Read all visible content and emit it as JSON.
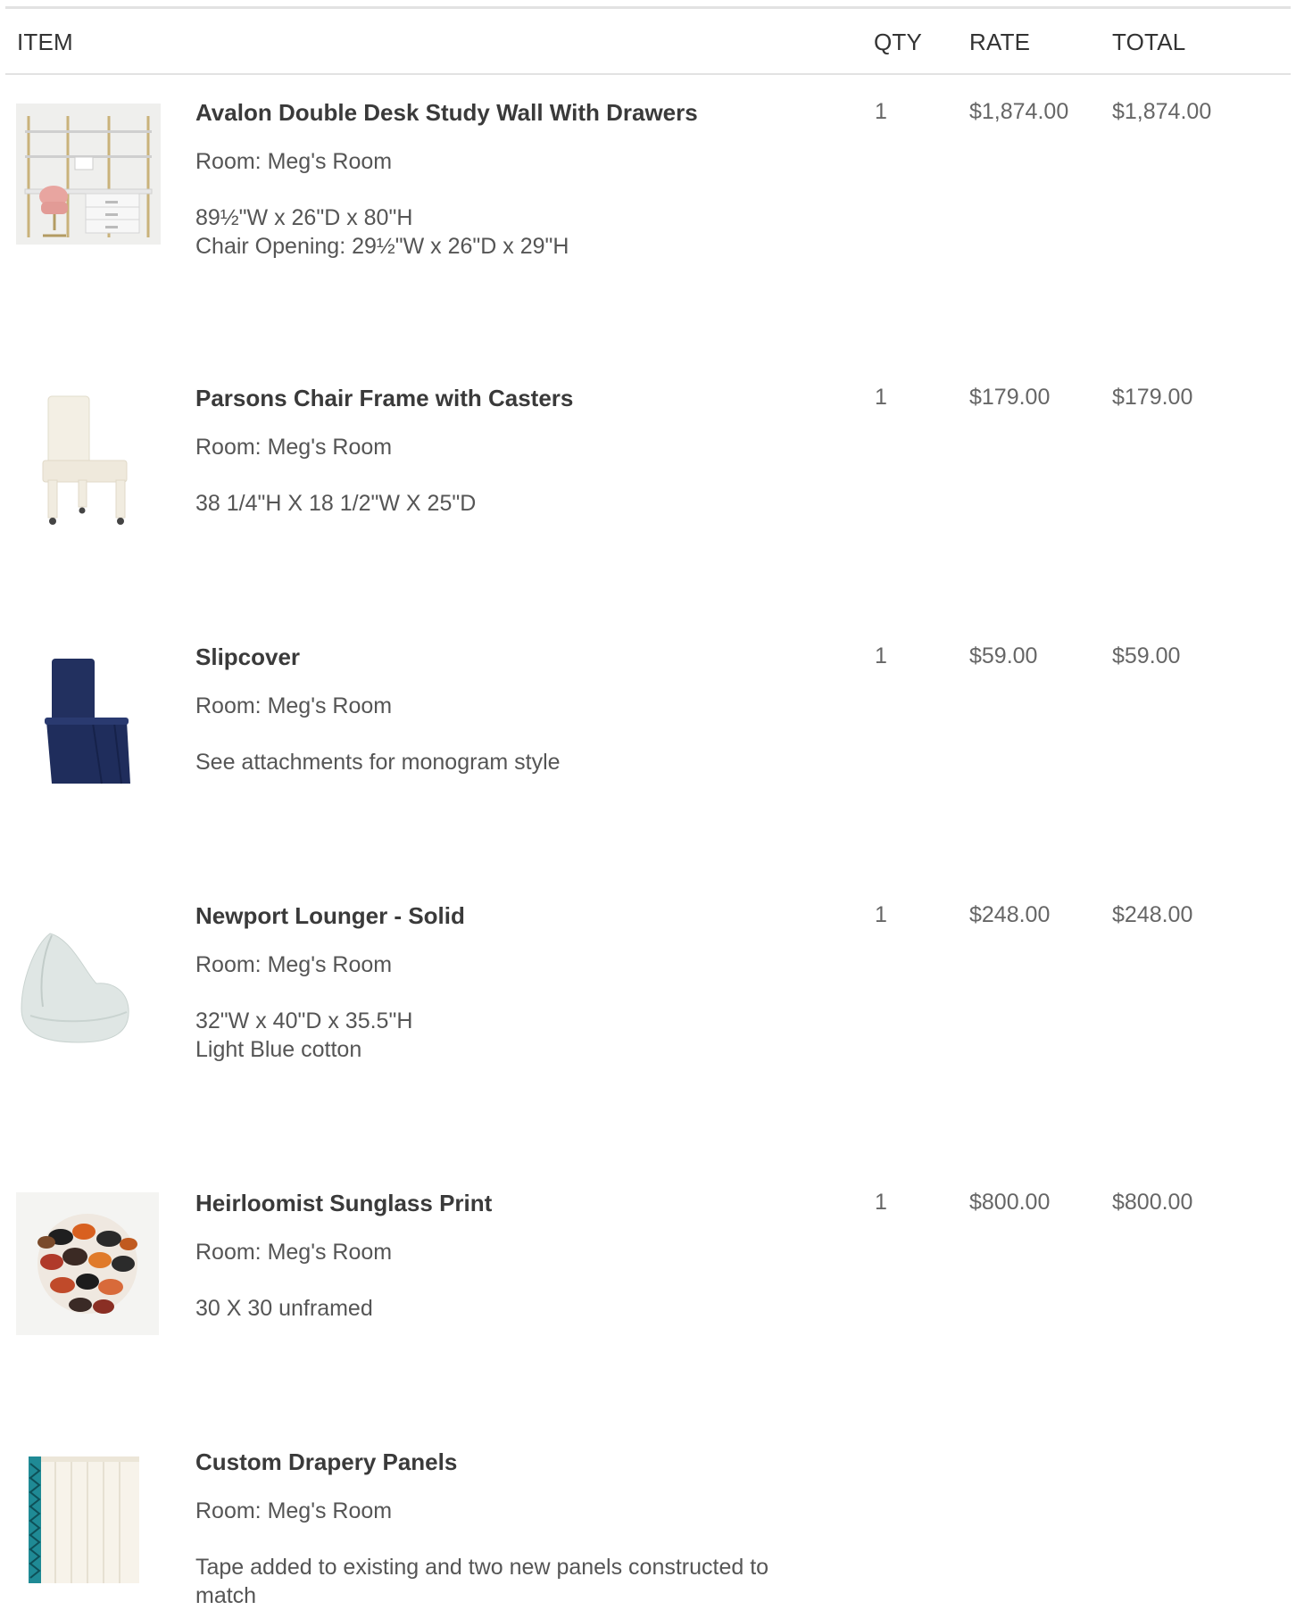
{
  "table": {
    "headers": {
      "item": "ITEM",
      "qty": "QTY",
      "rate": "RATE",
      "total": "TOTAL"
    },
    "rows": [
      {
        "name": "Avalon Double Desk Study Wall With Drawers",
        "room": "Room: Meg's Room",
        "notes": [
          "89½\"W x 26\"D x 80\"H",
          "Chair Opening: 29½\"W x 26\"D x 29\"H"
        ],
        "qty": "1",
        "rate": "$1,874.00",
        "total": "$1,874.00",
        "image_icon": "desk-wall-image"
      },
      {
        "name": "Parsons Chair Frame with Casters",
        "room": "Room: Meg's Room",
        "notes": [
          "38 1/4\"H X 18 1/2\"W X 25\"D"
        ],
        "qty": "1",
        "rate": "$179.00",
        "total": "$179.00",
        "image_icon": "chair-frame-image"
      },
      {
        "name": "Slipcover",
        "room": "Room: Meg's Room",
        "notes": [
          "See attachments for monogram style"
        ],
        "qty": "1",
        "rate": "$59.00",
        "total": "$59.00",
        "image_icon": "slipcover-image"
      },
      {
        "name": "Newport Lounger - Solid",
        "room": "Room: Meg's Room",
        "notes": [
          "32\"W x 40\"D x 35.5\"H",
          "Light Blue cotton"
        ],
        "qty": "1",
        "rate": "$248.00",
        "total": "$248.00",
        "image_icon": "lounger-image"
      },
      {
        "name": "Heirloomist Sunglass Print",
        "room": "Room: Meg's Room",
        "notes": [
          "30 X 30 unframed"
        ],
        "qty": "1",
        "rate": "$800.00",
        "total": "$800.00",
        "image_icon": "sunglass-print-image"
      },
      {
        "name": "Custom Drapery Panels",
        "room": "Room: Meg's Room",
        "notes": [
          "Tape added to existing and two new panels constructed to match"
        ],
        "qty": "",
        "rate": "",
        "total": "",
        "image_icon": "drapery-image"
      }
    ]
  },
  "colors": {
    "text": "#3a3a3a",
    "muted": "#555555",
    "rule": "#e2e2e2",
    "navy": "#1f2d5c",
    "teal": "#1f8a95"
  }
}
